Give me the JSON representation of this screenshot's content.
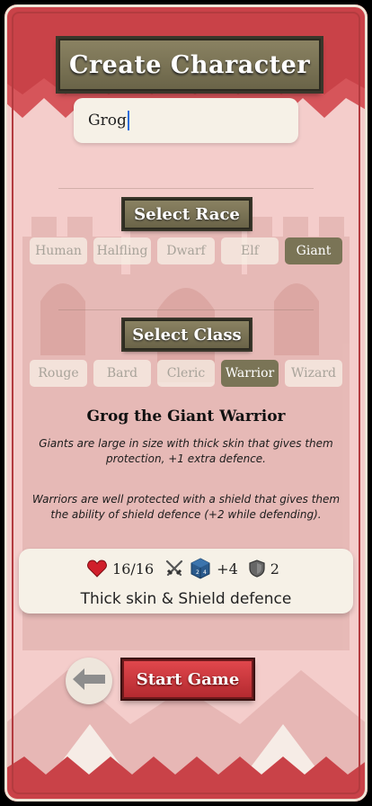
{
  "header": {
    "title": "Create Character"
  },
  "name_input": {
    "value": "Grog"
  },
  "race": {
    "title": "Select Race",
    "options": [
      "Human",
      "Halfling",
      "Dwarf",
      "Elf",
      "Giant"
    ],
    "selected": "Giant"
  },
  "class": {
    "title": "Select Class",
    "options": [
      "Rouge",
      "Bard",
      "Cleric",
      "Warrior",
      "Wizard"
    ],
    "selected": "Warrior"
  },
  "summary": {
    "heading": "Grog the Giant Warrior",
    "race_desc": "Giants are large in size with thick skin that gives them protection, +1 extra defence.",
    "class_desc": "Warriors are well protected with a shield that gives them the ability of shield defence (+2 while defending)."
  },
  "stats": {
    "health": "16/16",
    "attack": "+4",
    "defence": "2",
    "abilities": "Thick skin & Shield defence"
  },
  "actions": {
    "start_label": "Start Game"
  },
  "colors": {
    "accent": "#7a7456",
    "start_button": "#c8353a",
    "background": "#f4cdcb"
  }
}
